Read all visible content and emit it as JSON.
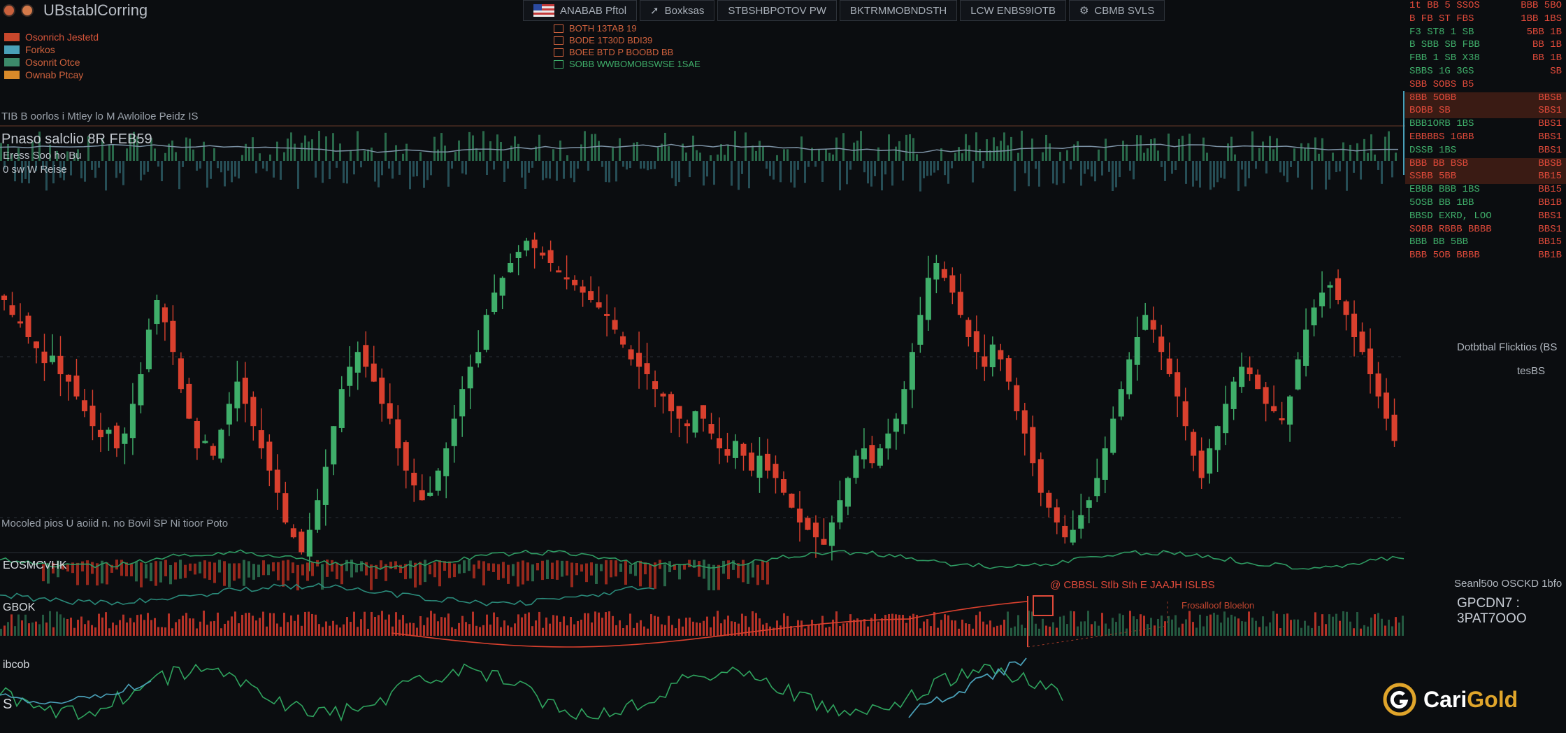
{
  "app": {
    "title": "UBstablCorring"
  },
  "legend": [
    {
      "label": "Osonrich Jestetd",
      "color": "#d9553a",
      "swatch": "#c7472c"
    },
    {
      "label": "Forkos",
      "color": "#d0623d",
      "swatch": "#4aa0b8"
    },
    {
      "label": "Osonrit Otce",
      "color": "#d0623d",
      "swatch": "#3c8a6a"
    },
    {
      "label": "Ownab Ptcay",
      "color": "#d0623d",
      "swatch": "#d88a2a"
    }
  ],
  "toolbar": {
    "buttons": [
      {
        "label": "ANABAB Pftol",
        "icon": "flag-icon"
      },
      {
        "label": "Boxksas",
        "icon": "cursor-icon"
      },
      {
        "label": "STBSHBPOTOV PW",
        "icon": ""
      },
      {
        "label": "BKTRMMOBNDSTH",
        "icon": ""
      },
      {
        "label": "LCW ENBS9IOTB",
        "icon": ""
      },
      {
        "label": "CBMB SVLS",
        "icon": "gear-icon"
      }
    ]
  },
  "indicators": [
    {
      "label": "BOTH 13TAB 19",
      "color": "#d0623d"
    },
    {
      "label": "BODE 1T30D BDI39",
      "color": "#d0623d"
    },
    {
      "label": "BOEE BTD P BOOBD BB",
      "color": "#d0623d"
    },
    {
      "label": "SOBB WWBOMOBSWSE 1SAE",
      "color": "#3fae6a"
    }
  ],
  "headers": {
    "line1": "TIB B oorlos i Mtley lo M Awloiloe Peidz IS",
    "line2": "Pnaso salclio 8R FEB59",
    "line3": "Eress Soo ho Bu",
    "line4": "0 sw W Reise",
    "lower": "Mocoled pios U aoiid n. no Bovil SP Ni tioor Poto",
    "band1": "EOSMCVHK",
    "band2": "GBOK",
    "band3": "ibcob",
    "band4": "S"
  },
  "annotations": {
    "main": "@ CBBSL Stlb Sth E JAAJH ISLBS",
    "sub": "Frosalloof Bloelon",
    "right1": "Dotbtbal Flicktios (BS",
    "right2": "tesBS",
    "right3": "Seanl50o OSCKD 1bfo",
    "right4": "GPCDN7 : 3PAT7OOO"
  },
  "right_panel": [
    {
      "l": "1t BB 5 SSOS",
      "r": "BBB 5BO",
      "lc": "#e04a3a",
      "rc": "#e04a3a",
      "hl": false
    },
    {
      "l": "B FB ST FBS",
      "r": "1BB 1BS",
      "lc": "#e04a3a",
      "rc": "#e04a3a",
      "hl": false
    },
    {
      "l": "F3 ST8 1 SB",
      "r": "5BB 1B",
      "lc": "#3fae6a",
      "rc": "#e04a3a",
      "hl": false
    },
    {
      "l": "B SBB SB FBB",
      "r": "BB 1B",
      "lc": "#3fae6a",
      "rc": "#e04a3a",
      "hl": false
    },
    {
      "l": "FBB 1 SB X38",
      "r": "BB 1B",
      "lc": "#3fae6a",
      "rc": "#e04a3a",
      "hl": false
    },
    {
      "l": "SBBS 1G 3GS",
      "r": "SB",
      "lc": "#3fae6a",
      "rc": "#e04a3a",
      "hl": false
    },
    {
      "l": "SBB SOBS B5",
      "r": "",
      "lc": "#e04a3a",
      "rc": "#e04a3a",
      "hl": false
    },
    {
      "l": "8BB 5OBB",
      "r": "BBSB",
      "lc": "#e04a3a",
      "rc": "#e04a3a",
      "hl": true
    },
    {
      "l": "BOBB SB",
      "r": "SBS1",
      "lc": "#e04a3a",
      "rc": "#e04a3a",
      "hl": true
    },
    {
      "l": "BBB1ORB 1BS",
      "r": "BBS1",
      "lc": "#3fae6a",
      "rc": "#e04a3a",
      "hl": false
    },
    {
      "l": "EBBBBS 1GBB",
      "r": "BBS1",
      "lc": "#e04a3a",
      "rc": "#e04a3a",
      "hl": false
    },
    {
      "l": "DSSB 1BS",
      "r": "BBS1",
      "lc": "#3fae6a",
      "rc": "#e04a3a",
      "hl": false
    },
    {
      "l": "BBB BB BSB",
      "r": "BBSB",
      "lc": "#e04a3a",
      "rc": "#e04a3a",
      "hl": true
    },
    {
      "l": "SSBB 5BB",
      "r": "BB15",
      "lc": "#e04a3a",
      "rc": "#e04a3a",
      "hl": true
    },
    {
      "l": "EBBB BBB 1BS",
      "r": "BB15",
      "lc": "#3fae6a",
      "rc": "#e04a3a",
      "hl": false
    },
    {
      "l": "5OSB BB 1BB",
      "r": "BB1B",
      "lc": "#3fae6a",
      "rc": "#e04a3a",
      "hl": false
    },
    {
      "l": "BBSD EXRD, LOO",
      "r": "BBS1",
      "lc": "#3fae6a",
      "rc": "#e04a3a",
      "hl": false
    },
    {
      "l": "SOBB RBBB BBBB",
      "r": "BBS1",
      "lc": "#e04a3a",
      "rc": "#e04a3a",
      "hl": false
    },
    {
      "l": "BBB BB 5BB",
      "r": "BB15",
      "lc": "#3fae6a",
      "rc": "#e04a3a",
      "hl": false
    },
    {
      "l": "BBB 5OB BBBB",
      "r": "BB1B",
      "lc": "#e04a3a",
      "rc": "#e04a3a",
      "hl": false
    }
  ],
  "logo": {
    "name1": "Cari",
    "name2": "Gold"
  },
  "colors": {
    "up": "#3fae6a",
    "down": "#d9402e",
    "bg": "#0b0d10",
    "accent": "#e0a52b"
  },
  "chart_data": {
    "type": "candlestick",
    "closes": [
      0.7,
      0.66,
      0.64,
      0.6,
      0.57,
      0.53,
      0.55,
      0.5,
      0.48,
      0.44,
      0.4,
      0.36,
      0.33,
      0.35,
      0.3,
      0.34,
      0.42,
      0.5,
      0.62,
      0.7,
      0.64,
      0.56,
      0.46,
      0.38,
      0.3,
      0.32,
      0.28,
      0.35,
      0.42,
      0.48,
      0.42,
      0.36,
      0.3,
      0.24,
      0.18,
      0.1,
      0.06,
      0.02,
      0.08,
      0.16,
      0.25,
      0.36,
      0.46,
      0.52,
      0.56,
      0.52,
      0.48,
      0.42,
      0.38,
      0.3,
      0.24,
      0.2,
      0.16,
      0.18,
      0.24,
      0.3,
      0.38,
      0.46,
      0.52,
      0.56,
      0.66,
      0.72,
      0.76,
      0.8,
      0.83,
      0.86,
      0.84,
      0.82,
      0.8,
      0.78,
      0.76,
      0.74,
      0.72,
      0.7,
      0.68,
      0.66,
      0.62,
      0.58,
      0.54,
      0.52,
      0.5,
      0.46,
      0.44,
      0.4,
      0.38,
      0.36,
      0.4,
      0.38,
      0.34,
      0.3,
      0.28,
      0.32,
      0.28,
      0.24,
      0.28,
      0.24,
      0.22,
      0.18,
      0.14,
      0.1,
      0.08,
      0.06,
      0.04,
      0.1,
      0.16,
      0.22,
      0.28,
      0.3,
      0.26,
      0.3,
      0.34,
      0.38,
      0.46,
      0.56,
      0.66,
      0.76,
      0.8,
      0.76,
      0.72,
      0.66,
      0.6,
      0.56,
      0.52,
      0.58,
      0.54,
      0.48,
      0.4,
      0.34,
      0.26,
      0.18,
      0.14,
      0.1,
      0.06,
      0.08,
      0.12,
      0.16,
      0.22,
      0.3,
      0.38,
      0.46,
      0.54,
      0.6,
      0.66,
      0.62,
      0.56,
      0.5,
      0.44,
      0.36,
      0.28,
      0.22,
      0.3,
      0.36,
      0.42,
      0.48,
      0.52,
      0.5,
      0.46,
      0.42,
      0.4,
      0.38,
      0.44,
      0.54,
      0.62,
      0.68,
      0.72,
      0.74,
      0.7,
      0.66,
      0.6,
      0.56,
      0.5,
      0.44,
      0.38,
      0.32
    ]
  }
}
